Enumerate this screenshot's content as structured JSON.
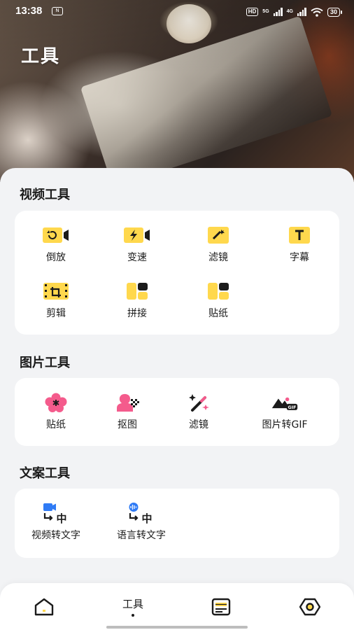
{
  "status_bar": {
    "time": "13:38",
    "hd_badge": "HD",
    "network_1": "5G",
    "network_2": "4G",
    "battery": "30"
  },
  "header": {
    "title": "工具"
  },
  "sections": {
    "video": {
      "title": "视频工具",
      "tools": [
        {
          "label": "倒放",
          "icon": "reverse-play-icon"
        },
        {
          "label": "变速",
          "icon": "speed-icon"
        },
        {
          "label": "滤镜",
          "icon": "filter-icon"
        },
        {
          "label": "字幕",
          "icon": "subtitle-icon"
        },
        {
          "label": "剪辑",
          "icon": "clip-edit-icon"
        },
        {
          "label": "拼接",
          "icon": "splice-icon"
        },
        {
          "label": "贴纸",
          "icon": "sticker-icon"
        }
      ]
    },
    "image": {
      "title": "图片工具",
      "tools": [
        {
          "label": "贴纸",
          "icon": "flower-sticker-icon"
        },
        {
          "label": "抠图",
          "icon": "cutout-icon"
        },
        {
          "label": "滤镜",
          "icon": "magic-wand-icon"
        },
        {
          "label": "图片转GIF",
          "icon": "gif-icon"
        }
      ]
    },
    "text": {
      "title": "文案工具",
      "tools": [
        {
          "label": "视频转文字",
          "icon": "video-to-text-icon",
          "glyph": "中"
        },
        {
          "label": "语言转文字",
          "icon": "voice-to-text-icon",
          "glyph": "中"
        }
      ]
    }
  },
  "bottom_nav": {
    "items": [
      {
        "label": "",
        "icon": "home-icon"
      },
      {
        "label": "工具",
        "icon": "",
        "active": true
      },
      {
        "label": "",
        "icon": "document-icon"
      },
      {
        "label": "",
        "icon": "settings-icon"
      }
    ]
  },
  "colors": {
    "accent_yellow": "#FFD84D",
    "pink": "#F45B8C",
    "blue": "#2F7BF5",
    "dark": "#1B1B1B"
  }
}
